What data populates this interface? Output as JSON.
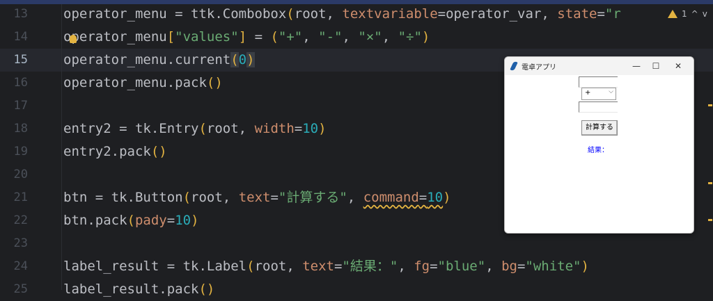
{
  "editor": {
    "lines": [
      {
        "num": "13",
        "tokens": [
          [
            "t-var",
            "operator_menu = ttk.Combobox"
          ],
          [
            "t-par",
            "("
          ],
          [
            "t-var",
            "root, "
          ],
          [
            "t-kw",
            "textvariable"
          ],
          [
            "t-var",
            "=operator_var, "
          ],
          [
            "t-kw",
            "state"
          ],
          [
            "t-var",
            "="
          ],
          [
            "t-str",
            "\"r"
          ]
        ]
      },
      {
        "num": "14",
        "tokens": [
          [
            "t-var",
            "operator_menu"
          ],
          [
            "t-par",
            "["
          ],
          [
            "t-str",
            "\"values\""
          ],
          [
            "t-par",
            "]"
          ],
          [
            "t-var",
            " = "
          ],
          [
            "t-par",
            "("
          ],
          [
            "t-str",
            "\"+\""
          ],
          [
            "t-var",
            ", "
          ],
          [
            "t-str",
            "\"-\""
          ],
          [
            "t-var",
            ", "
          ],
          [
            "t-str",
            "\"×\""
          ],
          [
            "t-var",
            ", "
          ],
          [
            "t-str",
            "\"÷\""
          ],
          [
            "t-par",
            ")"
          ]
        ]
      },
      {
        "num": "15",
        "tokens": [
          [
            "t-var",
            "operator_menu.current"
          ],
          [
            "t-par t-hl",
            "("
          ],
          [
            "t-num",
            "0"
          ],
          [
            "t-par t-hl",
            ")"
          ]
        ]
      },
      {
        "num": "16",
        "tokens": [
          [
            "t-var",
            "operator_menu.pack"
          ],
          [
            "t-par",
            "()"
          ]
        ]
      },
      {
        "num": "17",
        "tokens": []
      },
      {
        "num": "18",
        "tokens": [
          [
            "t-var",
            "entry2 = tk.Entry"
          ],
          [
            "t-par",
            "("
          ],
          [
            "t-var",
            "root, "
          ],
          [
            "t-kw",
            "width"
          ],
          [
            "t-var",
            "="
          ],
          [
            "t-num",
            "10"
          ],
          [
            "t-par",
            ")"
          ]
        ]
      },
      {
        "num": "19",
        "tokens": [
          [
            "t-var",
            "entry2.pack"
          ],
          [
            "t-par",
            "()"
          ]
        ]
      },
      {
        "num": "20",
        "tokens": []
      },
      {
        "num": "21",
        "tokens": [
          [
            "t-var",
            "btn = tk.Button"
          ],
          [
            "t-par",
            "("
          ],
          [
            "t-var",
            "root, "
          ],
          [
            "t-kw",
            "text"
          ],
          [
            "t-var",
            "="
          ],
          [
            "t-str",
            "\"計算する\""
          ],
          [
            "t-var",
            ", "
          ],
          [
            "t-kw squiggle",
            "command"
          ],
          [
            "t-var squiggle",
            "="
          ],
          [
            "t-num squiggle",
            "10"
          ],
          [
            "t-par",
            ")"
          ]
        ]
      },
      {
        "num": "22",
        "tokens": [
          [
            "t-var",
            "btn.pack"
          ],
          [
            "t-par",
            "("
          ],
          [
            "t-kw",
            "pady"
          ],
          [
            "t-var",
            "="
          ],
          [
            "t-num",
            "10"
          ],
          [
            "t-par",
            ")"
          ]
        ]
      },
      {
        "num": "23",
        "tokens": []
      },
      {
        "num": "24",
        "tokens": [
          [
            "t-var",
            "label_result = tk.Label"
          ],
          [
            "t-par",
            "("
          ],
          [
            "t-var",
            "root, "
          ],
          [
            "t-kw",
            "text"
          ],
          [
            "t-var",
            "="
          ],
          [
            "t-str",
            "\"結果：\""
          ],
          [
            "t-var",
            ", "
          ],
          [
            "t-kw",
            "fg"
          ],
          [
            "t-var",
            "="
          ],
          [
            "t-str",
            "\"blue\""
          ],
          [
            "t-var",
            ", "
          ],
          [
            "t-kw",
            "bg"
          ],
          [
            "t-var",
            "="
          ],
          [
            "t-str",
            "\"white\""
          ],
          [
            "t-par",
            ")"
          ]
        ]
      },
      {
        "num": "25",
        "tokens": [
          [
            "t-var",
            "label_result.pack"
          ],
          [
            "t-par",
            "()"
          ]
        ]
      }
    ],
    "current_line": "15",
    "inspection": {
      "warnings": "1",
      "up": "^",
      "down": "v"
    }
  },
  "tk_window": {
    "title": "電卓アプリ",
    "minimize": "—",
    "maximize": "☐",
    "close": "✕",
    "operator_value": "+",
    "operator_arrow": "⌵",
    "button_label": "計算する",
    "result_label": "結果："
  },
  "colors": {
    "warning": "#e3b341",
    "label_fg": "#0000ff"
  }
}
